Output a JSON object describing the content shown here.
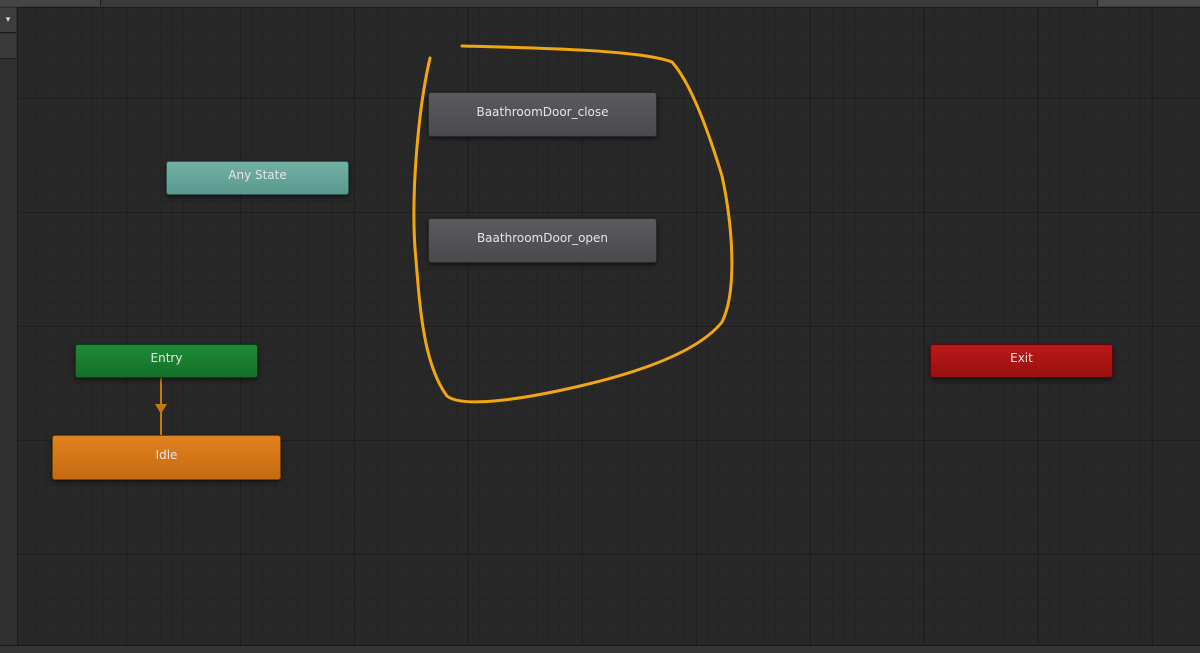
{
  "toolbar": {
    "dropdown_icon": "▾"
  },
  "graph": {
    "nodes": {
      "any_state": "Any State",
      "entry": "Entry",
      "exit": "Exit",
      "idle": "Idle",
      "door_close": "BaathroomDoor_close",
      "door_open": "BaathroomDoor_open"
    },
    "colors": {
      "any_state": "#6aa99c",
      "entry": "#1a7d30",
      "exit": "#aa1414",
      "idle": "#d97818",
      "state": "#515155",
      "transition": "#c57a10",
      "annotation": "#f2a60f",
      "background": "#282828"
    }
  }
}
